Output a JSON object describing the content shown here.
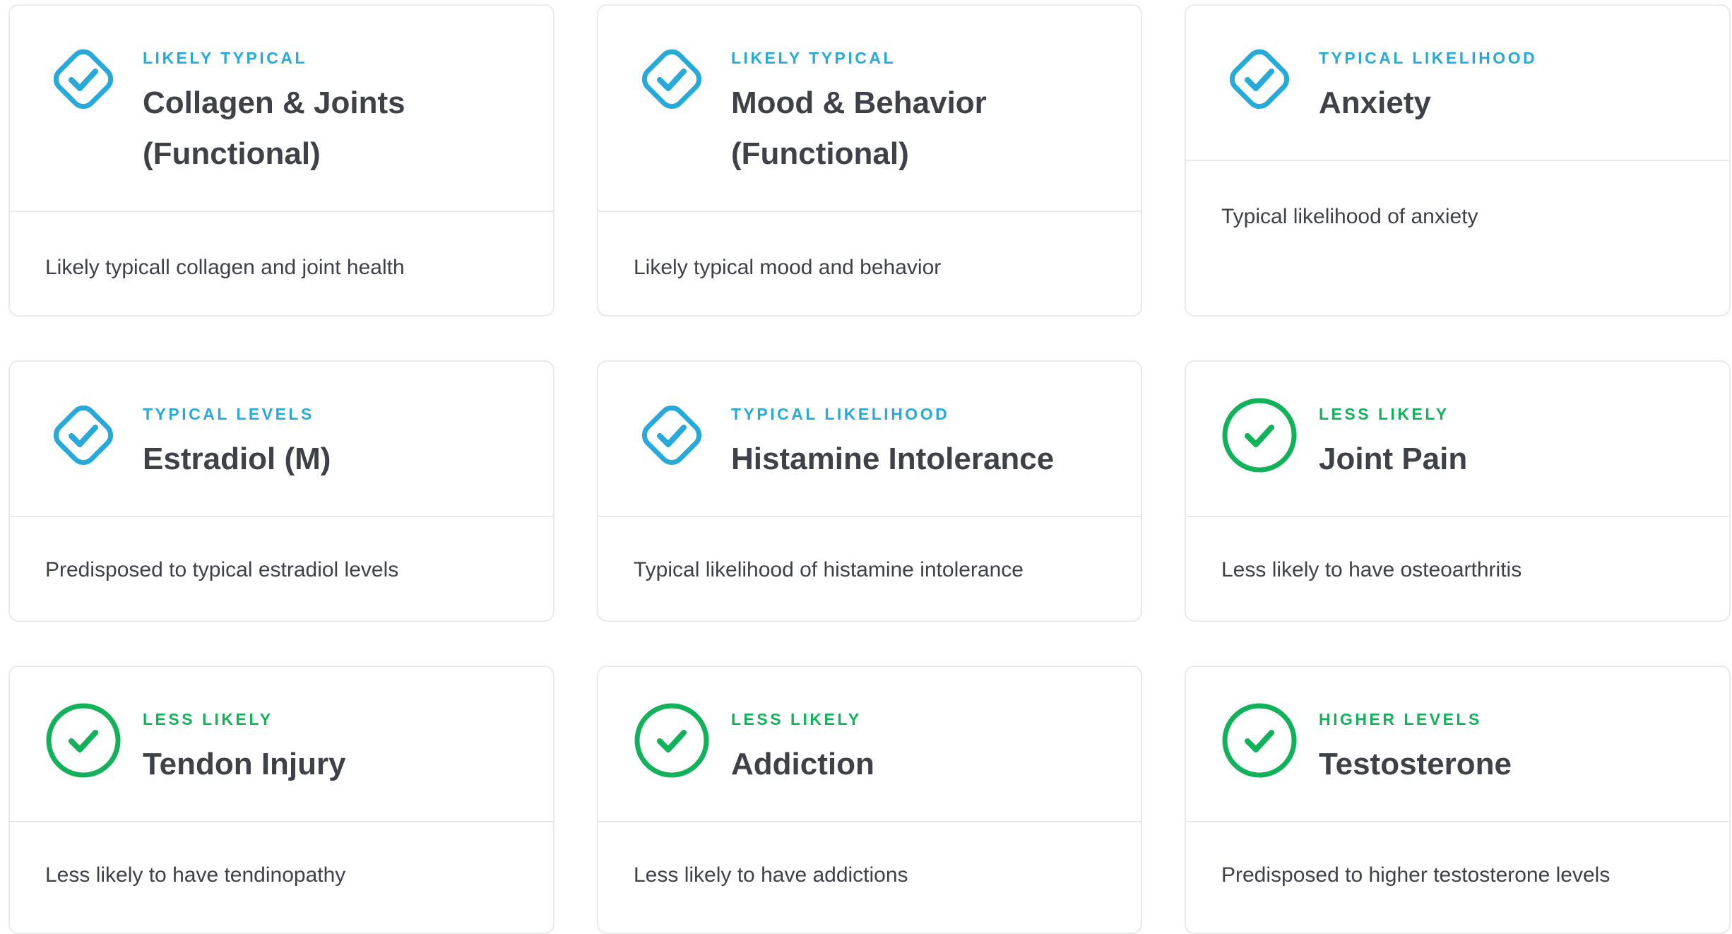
{
  "colors": {
    "typical": "#27a9d9",
    "positive": "#12b25a",
    "text": "#3f4148",
    "border": "#e8e9eb"
  },
  "cards": [
    {
      "status": "LIKELY TYPICAL",
      "title": "Collagen & Joints (Functional)",
      "description": "Likely typicall collagen and joint health",
      "icon": "diamond-check-icon",
      "tone": "typical"
    },
    {
      "status": "LIKELY TYPICAL",
      "title": "Mood & Behavior (Functional)",
      "description": "Likely typical mood and behavior",
      "icon": "diamond-check-icon",
      "tone": "typical"
    },
    {
      "status": "TYPICAL LIKELIHOOD",
      "title": "Anxiety",
      "description": "Typical likelihood of anxiety",
      "icon": "diamond-check-icon",
      "tone": "typical"
    },
    {
      "status": "TYPICAL LEVELS",
      "title": "Estradiol (M)",
      "description": "Predisposed to typical estradiol levels",
      "icon": "diamond-check-icon",
      "tone": "typical"
    },
    {
      "status": "TYPICAL LIKELIHOOD",
      "title": "Histamine Intolerance",
      "description": "Typical likelihood of histamine intolerance",
      "icon": "diamond-check-icon",
      "tone": "typical"
    },
    {
      "status": "LESS LIKELY",
      "title": "Joint Pain",
      "description": "Less likely to have osteoarthritis",
      "icon": "circle-check-icon",
      "tone": "positive"
    },
    {
      "status": "LESS LIKELY",
      "title": "Tendon Injury",
      "description": "Less likely to have tendinopathy",
      "icon": "circle-check-icon",
      "tone": "positive"
    },
    {
      "status": "LESS LIKELY",
      "title": "Addiction",
      "description": "Less likely to have addictions",
      "icon": "circle-check-icon",
      "tone": "positive"
    },
    {
      "status": "HIGHER LEVELS",
      "title": "Testosterone",
      "description": "Predisposed to higher testosterone levels",
      "icon": "circle-check-icon",
      "tone": "positive"
    }
  ]
}
